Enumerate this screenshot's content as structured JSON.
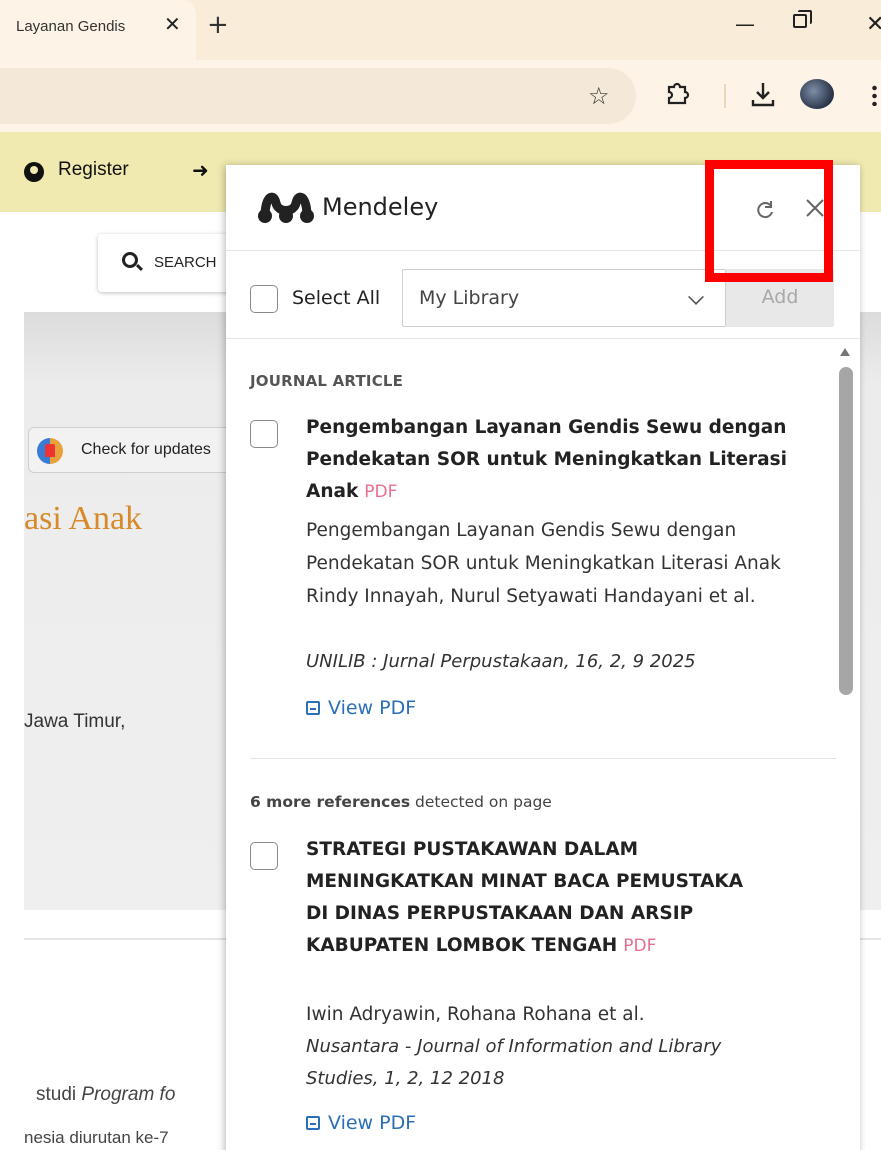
{
  "browser": {
    "tab_title": "Layanan Gendis",
    "tab_close": "✕",
    "new_tab": "+",
    "win_min": "—",
    "win_close": "✕",
    "star": "☆"
  },
  "site": {
    "nav_register": "Register",
    "search_label": "SEARCH",
    "check_updates": "Check for updates",
    "title_fragment": "asi Anak",
    "affiliation_fragment": "Jawa Timur,",
    "body_line1_a": "studi ",
    "body_line1_b": "Program fo",
    "body_line2": "nesia diurutan ke-7"
  },
  "mendeley": {
    "title": "Mendeley",
    "select_all": "Select All",
    "library": "My Library",
    "add": "Add",
    "section_label": "JOURNAL ARTICLE",
    "refs": [
      {
        "title": "Pengembangan Layanan Gendis Sewu dengan Pendekatan SOR untuk Meningkatkan Literasi Anak",
        "badge": "PDF",
        "text": "Pengembangan Layanan Gendis Sewu dengan Pendekatan SOR untuk Meningkatkan Literasi Anak Rindy Innayah, Nurul Setyawati Handayani et al.",
        "journal": "UNILIB : Jurnal Perpustakaan, 16, 2, 9 2025",
        "view_pdf": "View PDF"
      },
      {
        "title": "STRATEGI PUSTAKAWAN DALAM MENINGKATKAN MINAT BACA PEMUSTAKA DI DINAS PERPUSTAKAAN DAN ARSIP KABUPATEN LOMBOK TENGAH",
        "badge": "PDF",
        "text": "Iwin Adryawin, Rohana Rohana et al.",
        "journal": "Nusantara - Journal of Information and Library Studies, 1, 2, 12 2018",
        "view_pdf": "View PDF"
      }
    ],
    "more_refs_bold": "6 more references",
    "more_refs_rest": " detected on page"
  }
}
